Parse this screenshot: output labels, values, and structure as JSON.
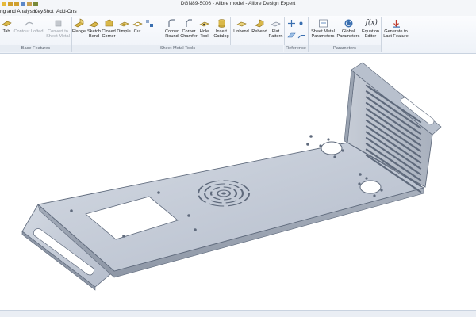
{
  "window": {
    "title": "DGN89-5006 - Alibre model - Alibre Design Expert"
  },
  "menu": {
    "items": [
      "ng and Analysis",
      "KeyShot",
      "Add-Ons"
    ]
  },
  "ribbon": {
    "buttons": {
      "tab": "Tab",
      "contour_l1": "Contour",
      "contour_l2": "Lofted",
      "convert_l1": "Convert to",
      "convert_l2": "Sheet Metal",
      "flange": "Flange",
      "sketch_l1": "Sketch",
      "sketch_l2": "Bend",
      "closed_l1": "Closed",
      "closed_l2": "Corner",
      "dimple": "Dimple",
      "cut": "Cut",
      "corner_round_l1": "Corner",
      "corner_round_l2": "Round",
      "corner_chamfer_l1": "Corner",
      "corner_chamfer_l2": "Chamfer",
      "hole_l1": "Hole",
      "hole_l2": "Tool",
      "insert_l1": "Insert",
      "insert_l2": "Catalog",
      "unbend": "Unbend",
      "rebend": "Rebend",
      "flat_l1": "Flat",
      "flat_l2": "Pattern",
      "smp_l1": "Sheet Metal",
      "smp_l2": "Parameters",
      "gp_l1": "Global",
      "gp_l2": "Parameters",
      "eq_l1": "Equation",
      "eq_l2": "Editor",
      "gen_l1": "Generate to",
      "gen_l2": "Last Feature"
    },
    "groups": {
      "base": "Base Features",
      "tools": "Sheet Metal Tools",
      "reference": "Reference",
      "parameters": "Parameters"
    },
    "icons": {
      "eq_symbol": "f(x)"
    }
  },
  "colors": {
    "part_top": "#c3cad6",
    "part_side": "#9aa3b1",
    "part_edge": "#5f6a7c",
    "ribbon_bg": "#eef2f8",
    "accent": "#3a6fb0"
  }
}
